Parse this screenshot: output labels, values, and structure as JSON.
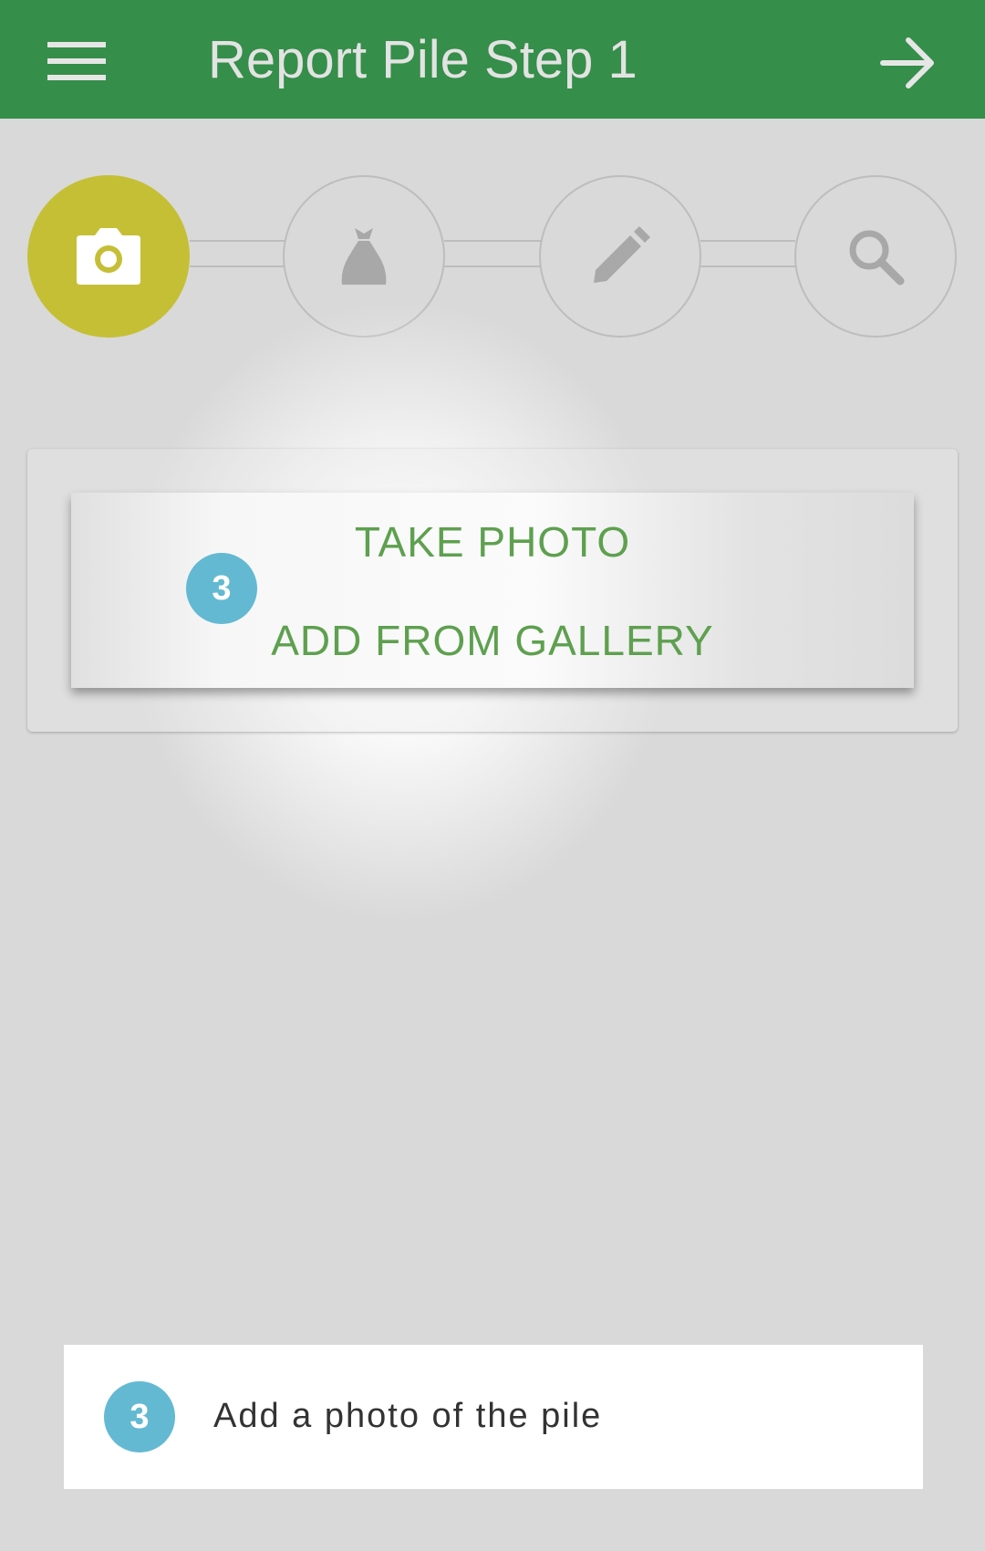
{
  "app_bar": {
    "title": "Report Pile Step 1",
    "menu_icon": "hamburger-menu-icon",
    "next_icon": "arrow-right-icon"
  },
  "stepper": {
    "steps": [
      {
        "icon": "camera-icon",
        "active": true
      },
      {
        "icon": "trash-bag-icon",
        "active": false
      },
      {
        "icon": "pencil-icon",
        "active": false
      },
      {
        "icon": "search-icon",
        "active": false
      }
    ]
  },
  "photo_dialog": {
    "take_photo_label": "TAKE PHOTO",
    "add_from_gallery_label": "ADD FROM GALLERY",
    "badge": "3"
  },
  "tutorial_hint": {
    "badge": "3",
    "text": "Add a photo of the pile"
  },
  "colors": {
    "app_bar": "#358e49",
    "active_step": "#c5bf36",
    "option_text": "#5ea04f",
    "badge": "#63b9d2",
    "background": "#d9d9d9"
  }
}
